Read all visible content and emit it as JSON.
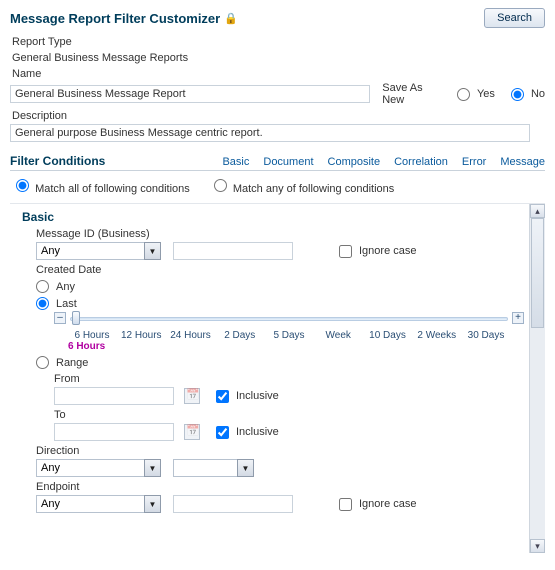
{
  "header": {
    "title": "Message Report Filter Customizer",
    "search_label": "Search"
  },
  "report_type": {
    "label": "Report Type",
    "value": "General Business Message Reports"
  },
  "name": {
    "label": "Name",
    "value": "General Business Message Report"
  },
  "save_as_new": {
    "label": "Save As New",
    "yes": "Yes",
    "no": "No"
  },
  "description": {
    "label": "Description",
    "value": "General purpose Business Message centric report."
  },
  "filter_section": {
    "title": "Filter Conditions",
    "tabs": {
      "basic": "Basic",
      "document": "Document",
      "composite": "Composite",
      "correlation": "Correlation",
      "error": "Error",
      "message": "Message"
    }
  },
  "match": {
    "all": "Match all of following conditions",
    "any": "Match any of following conditions"
  },
  "basic": {
    "title": "Basic",
    "message_id": {
      "label": "Message ID (Business)",
      "value": "Any",
      "ignore": "Ignore case"
    },
    "created_date": {
      "label": "Created Date",
      "any": "Any",
      "last": "Last",
      "range": "Range",
      "slider": {
        "ticks": {
          "t0": "6 Hours",
          "t1": "12 Hours",
          "t2": "24 Hours",
          "t3": "2 Days",
          "t4": "5 Days",
          "t5": "Week",
          "t6": "10 Days",
          "t7": "2 Weeks",
          "t8": "30 Days"
        },
        "value": "6 Hours"
      },
      "range_fields": {
        "from": "From",
        "to": "To",
        "inclusive": "Inclusive"
      }
    },
    "direction": {
      "label": "Direction",
      "value": "Any"
    },
    "endpoint": {
      "label": "Endpoint",
      "value": "Any",
      "ignore": "Ignore case"
    }
  }
}
